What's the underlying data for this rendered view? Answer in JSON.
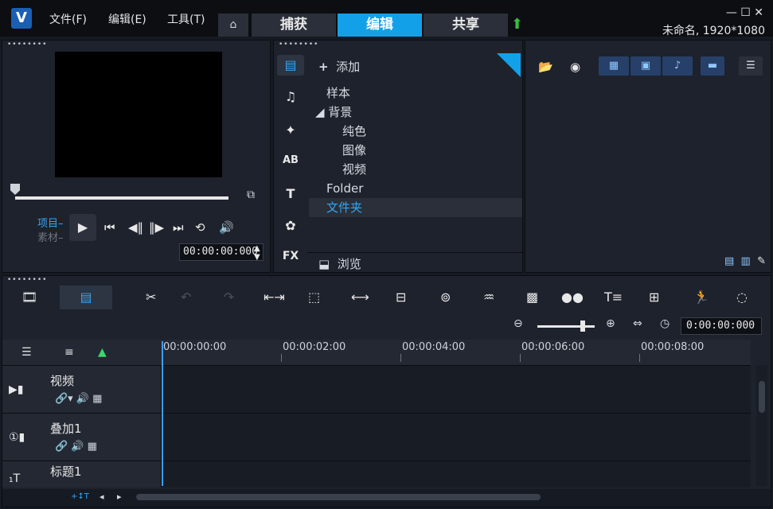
{
  "app": {
    "logo": "V",
    "menu": [
      "文件(F)",
      "编辑(E)",
      "工具(T)"
    ],
    "tabs": [
      "捕获",
      "编辑",
      "共享"
    ],
    "active_tab": "编辑",
    "window_controls": "—  ☐  ✕",
    "project_info": "未命名, 1920*1080"
  },
  "preview": {
    "mode_project": "项目–",
    "mode_clip": "素材–",
    "timecode": "00:00:00:000"
  },
  "library": {
    "add_label": "添加",
    "browse_label": "浏览",
    "tree": [
      {
        "label": "样本",
        "indent": 0
      },
      {
        "label": "◢ 背景",
        "indent": 0
      },
      {
        "label": "纯色",
        "indent": 1
      },
      {
        "label": "图像",
        "indent": 1
      },
      {
        "label": "视频",
        "indent": 1
      },
      {
        "label": "Folder",
        "indent": 0
      },
      {
        "label": "文件夹",
        "indent": 0,
        "selected": true
      }
    ],
    "side_icons": [
      "media-icon",
      "music-icon",
      "transition-icon",
      "title-ab-icon",
      "text-icon",
      "graphics-icon",
      "fx-icon"
    ],
    "fx_label": "FX"
  },
  "timeline": {
    "timecode": "0:00:00:000",
    "ruler": [
      "00:00:00:00",
      "00:00:02:00",
      "00:00:04:00",
      "00:00:06:00",
      "00:00:08:00"
    ],
    "tracks": [
      {
        "name": "视频",
        "type_icon": "video-track-icon",
        "tools": "🔗▾   🔊   ▦"
      },
      {
        "name": "叠加1",
        "type_icon": "overlay-track-icon",
        "tools": "🔗    🔊   ▦"
      },
      {
        "name": "标题1",
        "type_icon": "title-track-icon",
        "tools": ""
      }
    ]
  },
  "colors": {
    "accent": "#12a1e8",
    "background": "#1e222c",
    "selected_text": "#32a6f3"
  }
}
